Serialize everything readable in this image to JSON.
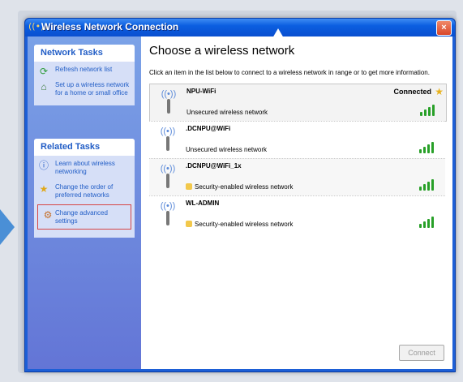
{
  "window": {
    "title": "Wireless Network Connection",
    "close_label": "×"
  },
  "sidebar": {
    "network_tasks": {
      "title": "Network Tasks",
      "items": [
        {
          "label": "Refresh network list",
          "icon": "refresh-icon"
        },
        {
          "label": "Set up a wireless network for a home or small office",
          "icon": "setup-network-icon"
        }
      ]
    },
    "related_tasks": {
      "title": "Related Tasks",
      "items": [
        {
          "label": "Learn about wireless networking",
          "icon": "info-icon"
        },
        {
          "label": "Change the order of preferred networks",
          "icon": "star-icon"
        },
        {
          "label": "Change advanced settings",
          "icon": "settings-icon"
        }
      ]
    }
  },
  "main": {
    "title": "Choose a wireless network",
    "instruction": "Click an item in the list below to connect to a wireless network in range or to get more information.",
    "connect_label": "Connect"
  },
  "networks": [
    {
      "ssid": "NPU-WiFi",
      "security": "Unsecured wireless network",
      "status": "Connected",
      "signal": 4,
      "locked": false
    },
    {
      "ssid": ".DCNPU@WiFi",
      "security": "Unsecured wireless network",
      "status": "",
      "signal": 4,
      "locked": false
    },
    {
      "ssid": ".DCNPU@WiFi_1x",
      "security": "Security-enabled wireless network",
      "status": "",
      "signal": 4,
      "locked": true
    },
    {
      "ssid": "WL-ADMIN",
      "security": "Security-enabled wireless network",
      "status": "",
      "signal": 4,
      "locked": true
    }
  ],
  "colors": {
    "titlebar": "#0b5ee0",
    "sidebar": "#6f8cdf",
    "link": "#215dc6",
    "signal": "#28a028"
  }
}
